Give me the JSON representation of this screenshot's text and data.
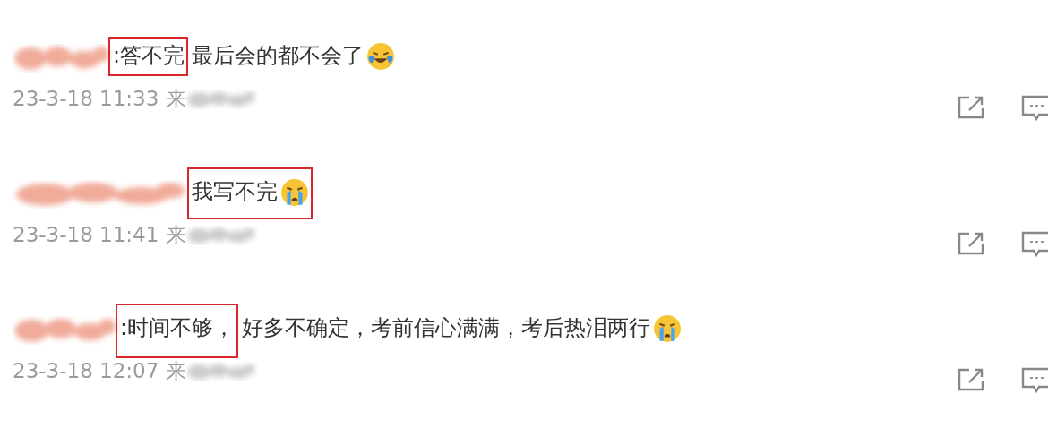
{
  "comments": [
    {
      "highlight": ":答不完",
      "text": " 最后会的都不会了",
      "emoji_laughing": true,
      "annotation_reaches_emoji": false,
      "annotation_reaches_date": false,
      "time": "23-3-18 11:33",
      "source": "来"
    },
    {
      "highlight": "我写不完",
      "emoji_laughing": false,
      "annotation_reaches_emoji": true,
      "annotation_reaches_date": false,
      "time": "23-3-18 11:41",
      "source": "来"
    },
    {
      "highlight": ":时间不够，",
      "text": "好多不确定，考前信心满满，考后热泪两行",
      "emoji_laughing": false,
      "annotation_reaches_emoji": false,
      "annotation_reaches_date": true,
      "time": "23-3-18 12:07",
      "source": "来"
    }
  ]
}
